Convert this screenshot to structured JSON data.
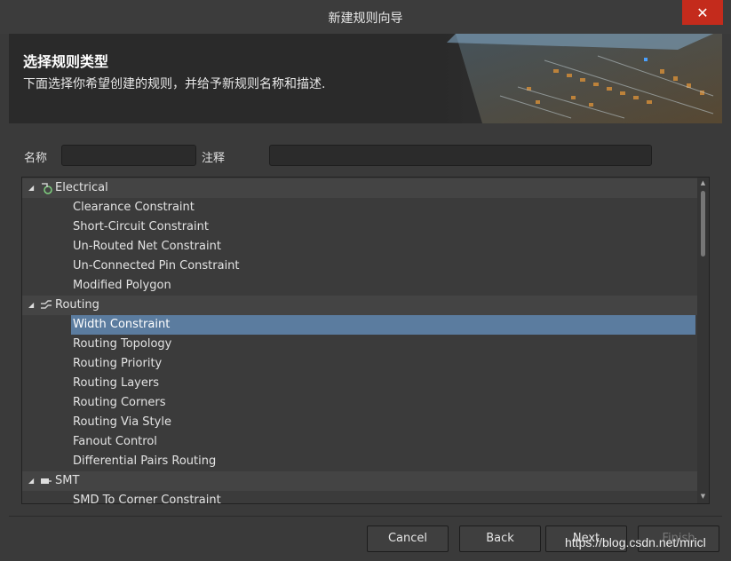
{
  "window": {
    "title": "新建规则向导",
    "close_symbol": "✕"
  },
  "banner": {
    "heading": "选择规则类型",
    "description": "下面选择你希望创建的规则，并给予新规则名称和描述."
  },
  "form": {
    "name_label": "名称",
    "name_value": "",
    "comment_label": "注释",
    "comment_value": ""
  },
  "tree": {
    "groups": [
      {
        "label": "Electrical",
        "icon": "electrical-icon",
        "items": [
          "Clearance Constraint",
          "Short-Circuit Constraint",
          "Un-Routed Net Constraint",
          "Un-Connected Pin Constraint",
          "Modified Polygon"
        ]
      },
      {
        "label": "Routing",
        "icon": "routing-icon",
        "items": [
          "Width Constraint",
          "Routing Topology",
          "Routing Priority",
          "Routing Layers",
          "Routing Corners",
          "Routing Via Style",
          "Fanout Control",
          "Differential Pairs Routing"
        ]
      },
      {
        "label": "SMT",
        "icon": "smt-icon",
        "items": [
          "SMD To Corner Constraint"
        ]
      }
    ],
    "selected": "Width Constraint"
  },
  "buttons": {
    "cancel": "Cancel",
    "back": "Back",
    "next": "Next",
    "finish": "Finish"
  },
  "watermark": "https://blog.csdn.net/mricl",
  "colors": {
    "selection": "#5b7c9f",
    "close": "#c42b1c"
  }
}
